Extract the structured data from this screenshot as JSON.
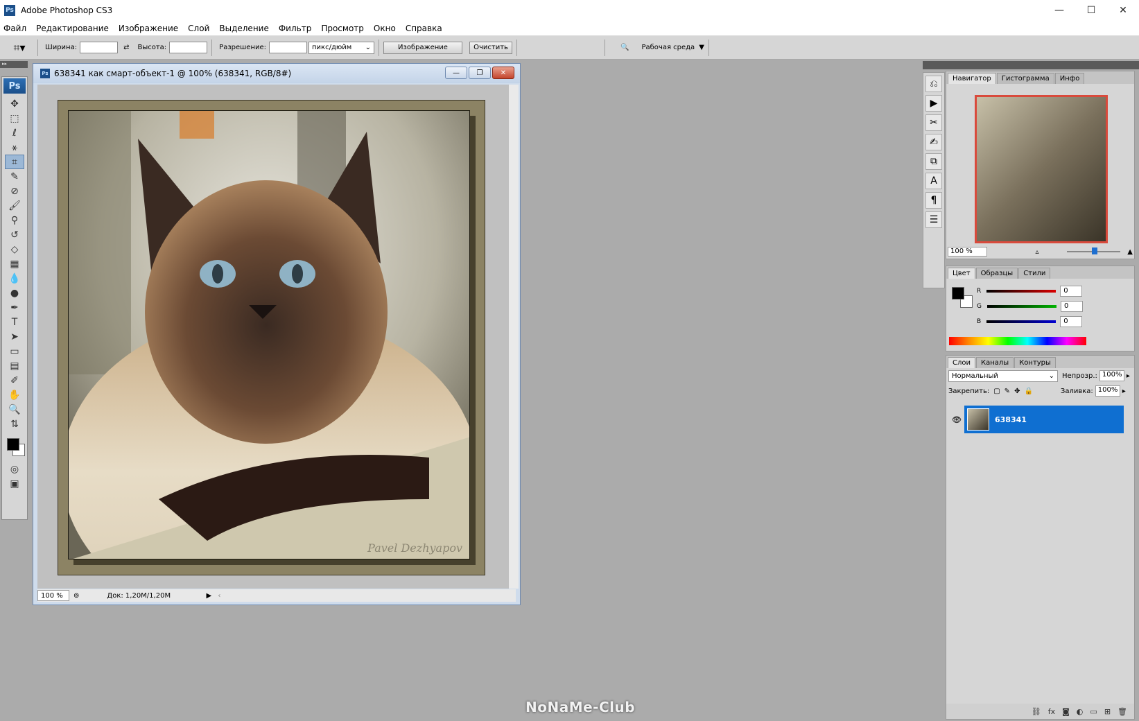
{
  "app": {
    "logo": "Ps",
    "title": "Adobe Photoshop CS3"
  },
  "window_controls": {
    "minimize": "—",
    "maximize": "☐",
    "close": "✕"
  },
  "menu": [
    "Файл",
    "Редактирование",
    "Изображение",
    "Слой",
    "Выделение",
    "Фильтр",
    "Просмотр",
    "Окно",
    "Справка"
  ],
  "options": {
    "width_label": "Ширина:",
    "height_label": "Высота:",
    "resolution_label": "Разрешение:",
    "units": "пикс/дюйм",
    "image_button": "Изображение",
    "clear_button": "Очистить",
    "workspace": "Рабочая среда"
  },
  "tools_header": "▸▸",
  "tools_logo": "Ps",
  "document": {
    "icon": "Ps",
    "title": "638341 как смарт-объект-1 @ 100% (638341, RGB/8#)",
    "zoom": "100 %",
    "info": "Док: 1,20M/1,20M",
    "watermark": "Pavel Dezhyapov"
  },
  "navigator": {
    "tabs": [
      "Навигатор",
      "Гистограмма",
      "Инфо"
    ],
    "zoom": "100 %",
    "zoom_level": 0.5
  },
  "color": {
    "tabs": [
      "Цвет",
      "Образцы",
      "Стили"
    ],
    "channels": [
      {
        "label": "R",
        "value": "0",
        "color": "#d90000"
      },
      {
        "label": "G",
        "value": "0",
        "color": "#00b400"
      },
      {
        "label": "B",
        "value": "0",
        "color": "#0000d0"
      }
    ],
    "fg": "#000000",
    "bg": "#ffffff"
  },
  "layers": {
    "tabs": [
      "Слои",
      "Каналы",
      "Контуры"
    ],
    "blend_mode": "Нормальный",
    "opacity_label": "Непрозр.:",
    "opacity": "100%",
    "lock_label": "Закрепить:",
    "fill_label": "Заливка:",
    "fill": "100%",
    "layer_name": "638341"
  },
  "footer": "NoNaMe-Club"
}
